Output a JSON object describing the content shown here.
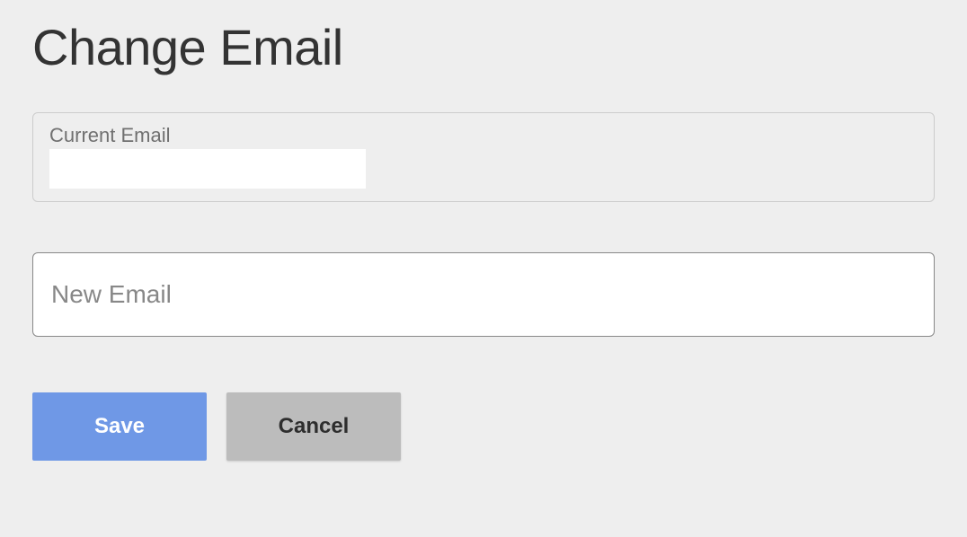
{
  "page": {
    "title": "Change Email"
  },
  "currentEmail": {
    "label": "Current Email",
    "value": ""
  },
  "newEmail": {
    "placeholder": "New Email",
    "value": ""
  },
  "buttons": {
    "save": "Save",
    "cancel": "Cancel"
  }
}
